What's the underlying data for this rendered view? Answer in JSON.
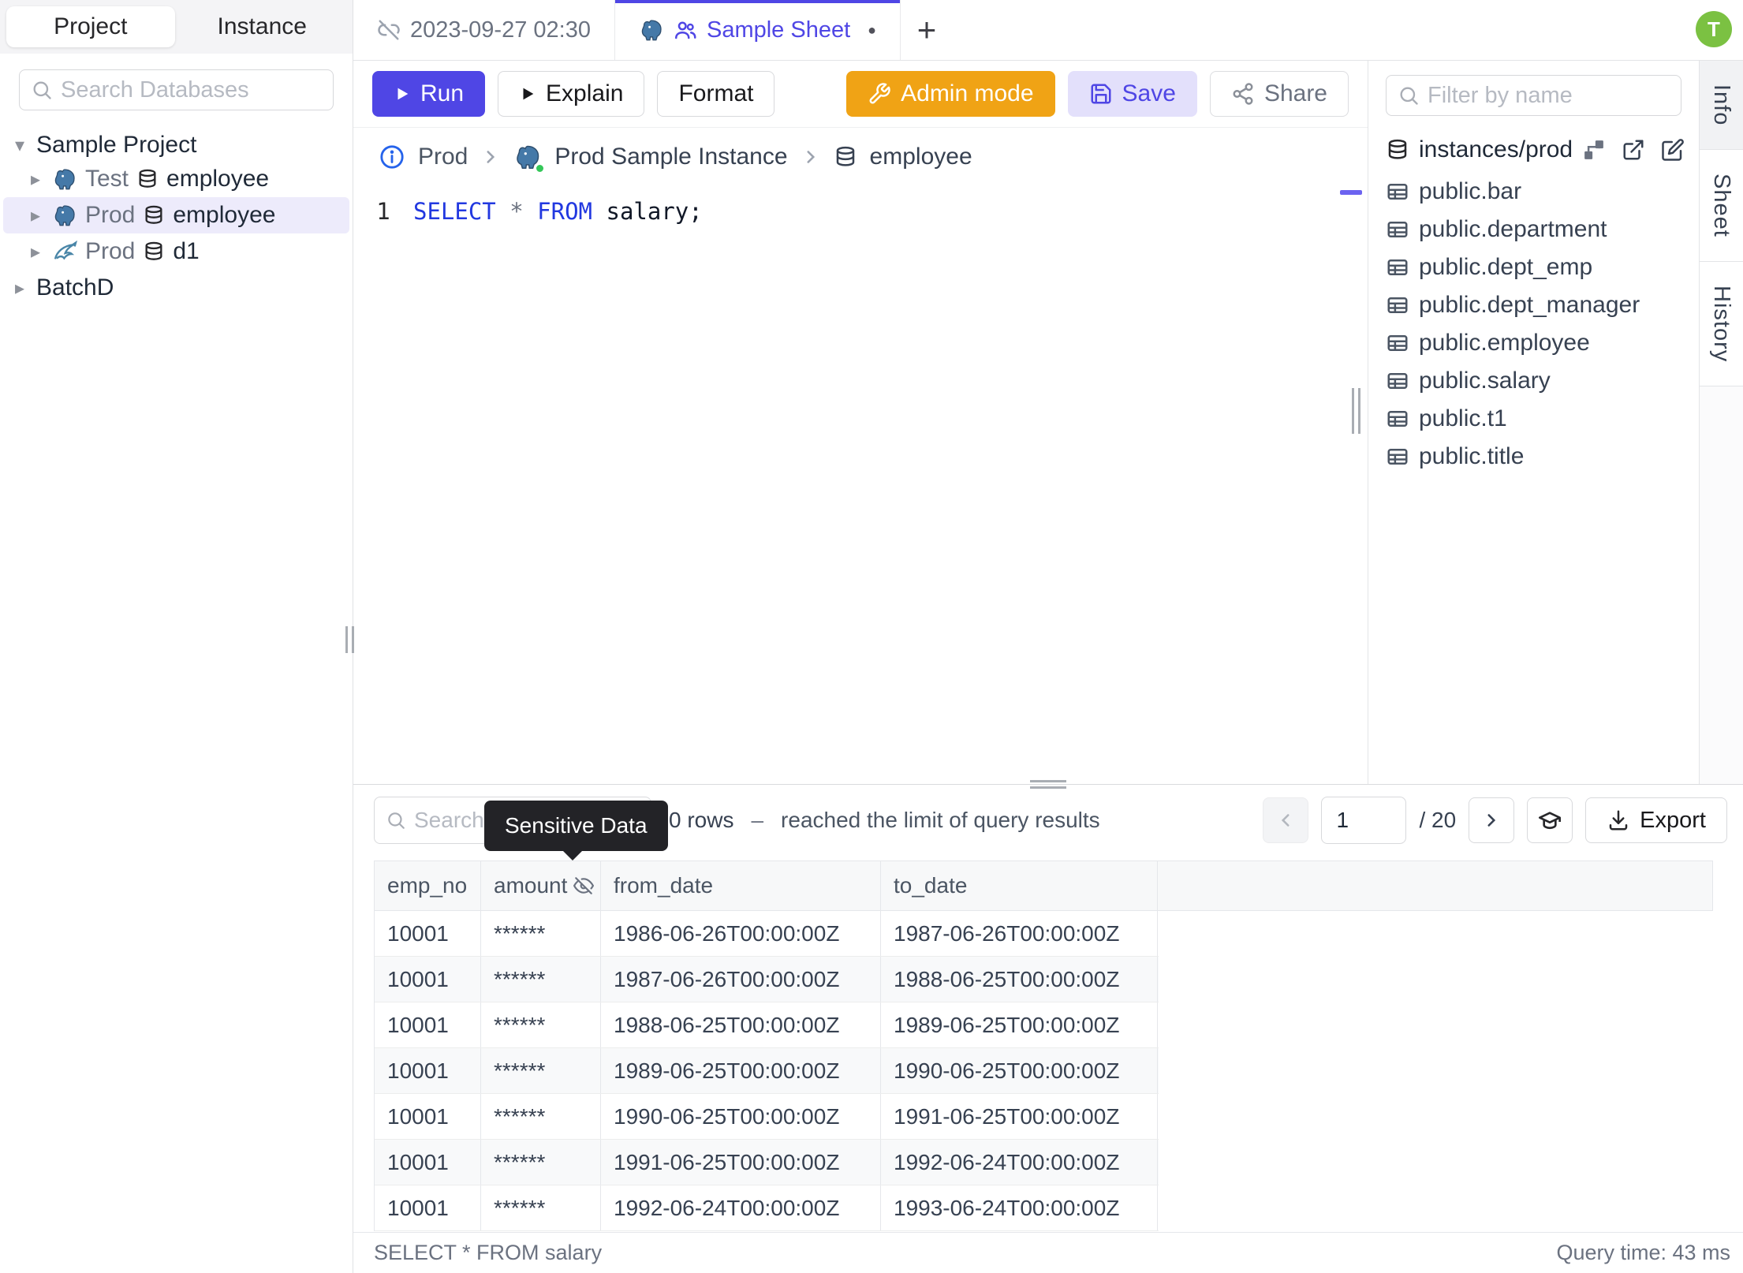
{
  "left_sidebar": {
    "tabs": [
      {
        "label": "Project"
      },
      {
        "label": "Instance"
      }
    ],
    "search_placeholder": "Search Databases",
    "project_label": "Sample Project",
    "tree_items": [
      {
        "env": "Test",
        "db": "employee",
        "engine": "postgres"
      },
      {
        "env": "Prod",
        "db": "employee",
        "engine": "postgres"
      },
      {
        "env": "Prod",
        "db": "d1",
        "engine": "mysql"
      }
    ],
    "batch_label": "BatchD"
  },
  "icons": {
    "caret_down": "▾",
    "caret_right": "▸",
    "plus": "+",
    "dirty_dot": "●"
  },
  "tab_bar": {
    "history_tab": "2023-09-27 02:30",
    "sheet_tab": "Sample Sheet",
    "avatar_initial": "T"
  },
  "toolbar": {
    "run_label": "Run",
    "explain_label": "Explain",
    "format_label": "Format",
    "admin_mode_label": "Admin mode",
    "save_label": "Save",
    "share_label": "Share"
  },
  "breadcrumb": {
    "environment": "Prod",
    "instance": "Prod Sample Instance",
    "database": "employee"
  },
  "editor": {
    "line_number": "1",
    "kw_select": "SELECT",
    "star": "*",
    "kw_from": "FROM",
    "rest": "salary;"
  },
  "schema_panel": {
    "filter_placeholder": "Filter by name",
    "resource_path": "instances/prod",
    "tables": [
      "public.bar",
      "public.department",
      "public.dept_emp",
      "public.dept_manager",
      "public.employee",
      "public.salary",
      "public.t1",
      "public.title"
    ]
  },
  "side_tabs": {
    "info": "Info",
    "sheet": "Sheet",
    "history": "History"
  },
  "results": {
    "search_placeholder": "Search",
    "tooltip": "Sensitive Data",
    "row_count": "0 rows",
    "dash": "–",
    "limit_text": "reached the limit of query results",
    "page": "1",
    "page_total": "/ 20",
    "export_label": "Export",
    "columns": [
      "emp_no",
      "amount",
      "from_date",
      "to_date"
    ],
    "rows": [
      [
        "10001",
        "******",
        "1986-06-26T00:00:00Z",
        "1987-06-26T00:00:00Z"
      ],
      [
        "10001",
        "******",
        "1987-06-26T00:00:00Z",
        "1988-06-25T00:00:00Z"
      ],
      [
        "10001",
        "******",
        "1988-06-25T00:00:00Z",
        "1989-06-25T00:00:00Z"
      ],
      [
        "10001",
        "******",
        "1989-06-25T00:00:00Z",
        "1990-06-25T00:00:00Z"
      ],
      [
        "10001",
        "******",
        "1990-06-25T00:00:00Z",
        "1991-06-25T00:00:00Z"
      ],
      [
        "10001",
        "******",
        "1991-06-25T00:00:00Z",
        "1992-06-24T00:00:00Z"
      ],
      [
        "10001",
        "******",
        "1992-06-24T00:00:00Z",
        "1993-06-24T00:00:00Z"
      ]
    ],
    "status_left": "SELECT * FROM salary",
    "status_right": "Query time: 43 ms"
  }
}
